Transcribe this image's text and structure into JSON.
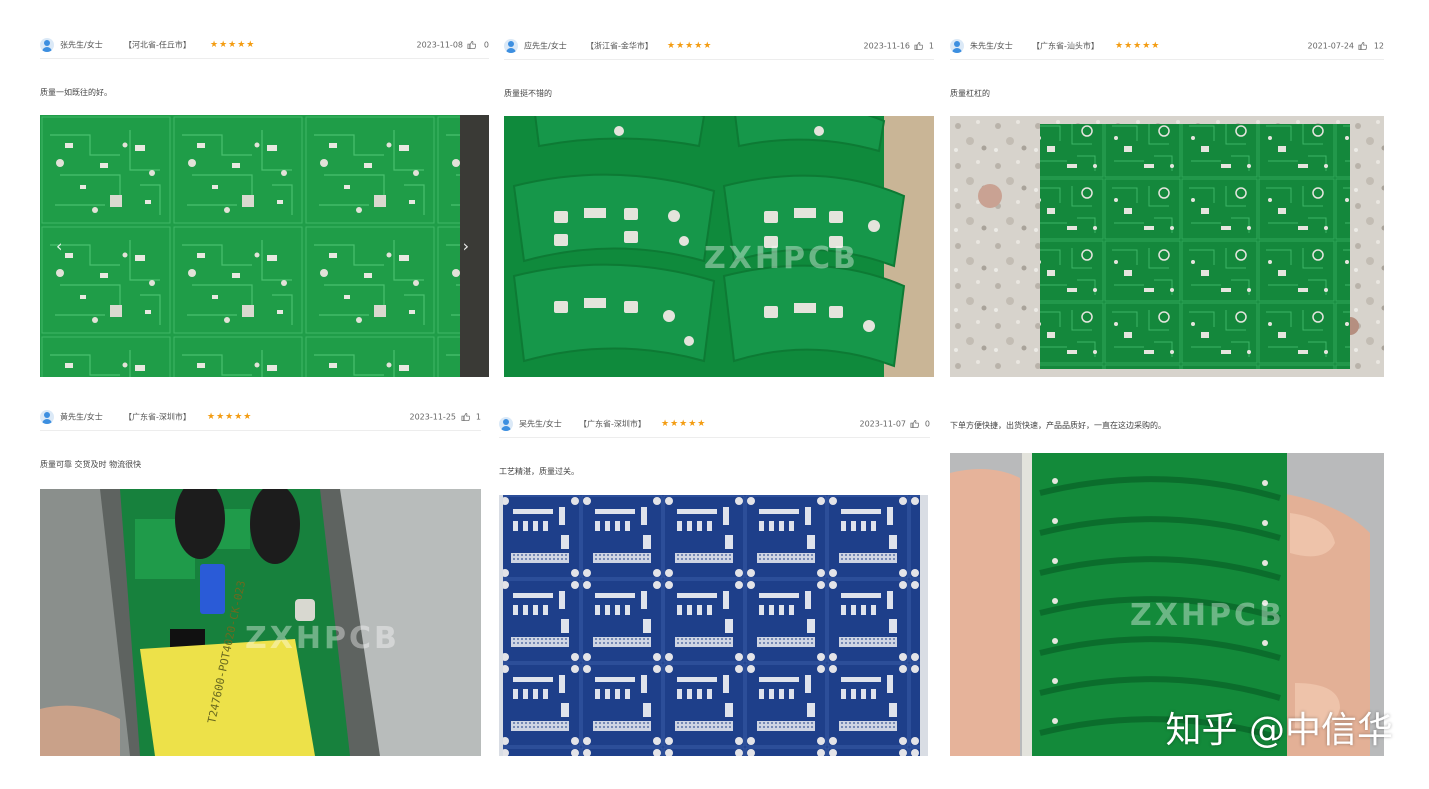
{
  "reviews": [
    {
      "user": "张先生/女士",
      "location": "【河北省-任丘市】",
      "stars": "★★★★★",
      "date": "2023-11-08",
      "likes": "0",
      "comment": "质量一如既往的好。"
    },
    {
      "user": "应先生/女士",
      "location": "【浙江省-金华市】",
      "stars": "★★★★★",
      "date": "2023-11-16",
      "likes": "1",
      "comment": "质量挺不错的"
    },
    {
      "user": "朱先生/女士",
      "location": "【广东省-汕头市】",
      "stars": "★★★★★",
      "date": "2021-07-24",
      "likes": "12",
      "comment": "质量杠杠的"
    },
    {
      "user": "黄先生/女士",
      "location": "【广东省-深圳市】",
      "stars": "★★★★★",
      "date": "2023-11-25",
      "likes": "1",
      "comment": "质量可靠 交货及时 物流很快"
    },
    {
      "user": "吴先生/女士",
      "location": "【广东省-深圳市】",
      "stars": "★★★★★",
      "date": "2023-11-07",
      "likes": "0",
      "comment": "工艺精湛，质量过关。"
    },
    {
      "comment": "下单方便快捷，出货快速，产品品质好，一直在这边采购的。"
    }
  ],
  "watermarks": {
    "brand": "ZXHPCB",
    "site": "知乎 @中信华"
  },
  "nav": {
    "prev": "‹",
    "next": "›"
  },
  "colors": {
    "pcb_green": "#1d9a45",
    "pcb_blue": "#1e3f8a",
    "star": "#f39c12",
    "avatar": "#3d8fe0"
  }
}
